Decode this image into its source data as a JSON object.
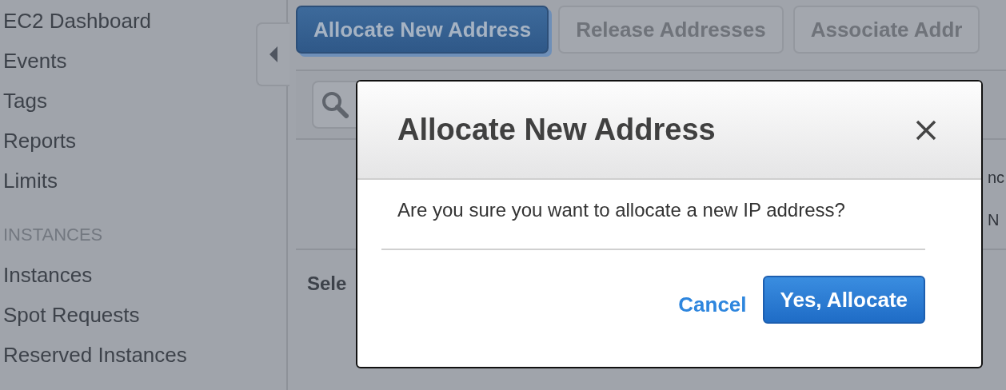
{
  "sidebar": {
    "items": [
      {
        "label": "EC2 Dashboard",
        "kind": "item"
      },
      {
        "label": "Events",
        "kind": "item"
      },
      {
        "label": "Tags",
        "kind": "item"
      },
      {
        "label": "Reports",
        "kind": "item"
      },
      {
        "label": "Limits",
        "kind": "item"
      },
      {
        "label": "INSTANCES",
        "kind": "header"
      },
      {
        "label": "Instances",
        "kind": "item"
      },
      {
        "label": "Spot Requests",
        "kind": "item"
      },
      {
        "label": "Reserved Instances",
        "kind": "item"
      }
    ]
  },
  "toolbar": {
    "buttons": [
      {
        "label": "Allocate New Address",
        "disabled": false
      },
      {
        "label": "Release Addresses",
        "disabled": true
      },
      {
        "label": "Associate Addr",
        "disabled": true
      }
    ]
  },
  "table": {
    "column_fragments": [
      "nc",
      "N"
    ],
    "selection_hint": "Sele"
  },
  "dialog": {
    "title": "Allocate New Address",
    "message": "Are you sure you want to allocate a new IP address?",
    "actions": [
      {
        "label": "Cancel",
        "kind": "link"
      },
      {
        "label": "Yes, Allocate",
        "kind": "primary"
      }
    ]
  }
}
